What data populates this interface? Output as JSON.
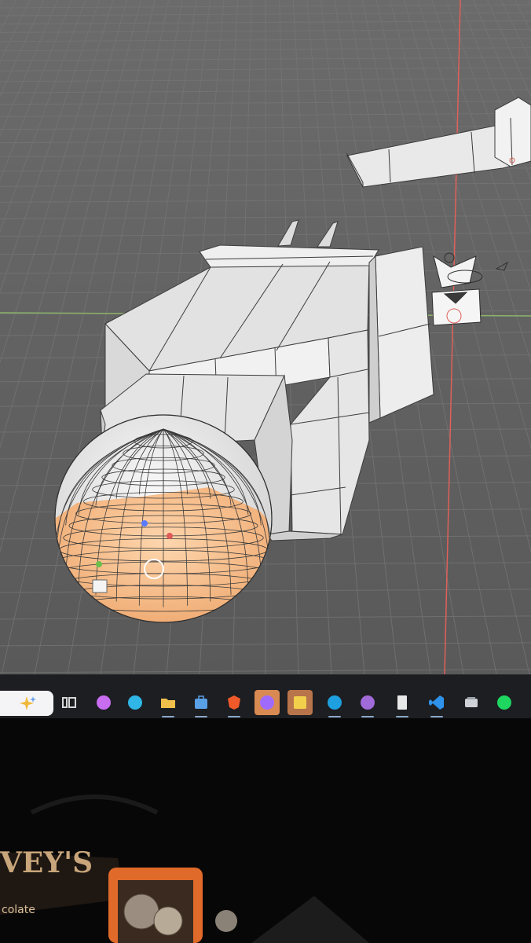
{
  "app": {
    "name": "Blender",
    "viewport_bg": "#5a5a5a",
    "grid_color": "#6a6a6a",
    "x_axis_color": "#7fae5a",
    "y_axis_color": "#d9534f",
    "selection_color": "#f0a060"
  },
  "viewport": {
    "objects": [
      "sphere",
      "main-block",
      "side-panel",
      "front-step",
      "arm-bar",
      "arm-head",
      "camera",
      "light"
    ]
  },
  "taskbar": {
    "search_icon": "sparkle-search-icon",
    "items": [
      {
        "name": "task-view-icon",
        "color": "#d8d8d8"
      },
      {
        "name": "copilot-icon",
        "color": "#c86cf0"
      },
      {
        "name": "edge-icon",
        "color": "#2fb6e6"
      },
      {
        "name": "file-explorer-icon",
        "color": "#f0c04a"
      },
      {
        "name": "microsoft-store-icon",
        "color": "#5aa0e6"
      },
      {
        "name": "brave-icon",
        "color": "#f05a2a"
      },
      {
        "name": "blender-icon",
        "color": "#9f6bff"
      },
      {
        "name": "sticky-notes-icon",
        "color": "#f2d04b"
      },
      {
        "name": "skype-icon",
        "color": "#1ea0e0"
      },
      {
        "name": "github-desktop-icon",
        "color": "#a06ad8"
      },
      {
        "name": "notepad-icon",
        "color": "#e8e8e8"
      },
      {
        "name": "vscode-icon",
        "color": "#2f92ea"
      },
      {
        "name": "file-manager-icon",
        "color": "#cfd3d8"
      },
      {
        "name": "spotify-icon",
        "color": "#1ed760"
      }
    ]
  },
  "desk": {
    "label_text": "colate",
    "brand_text": "VEY'S"
  }
}
